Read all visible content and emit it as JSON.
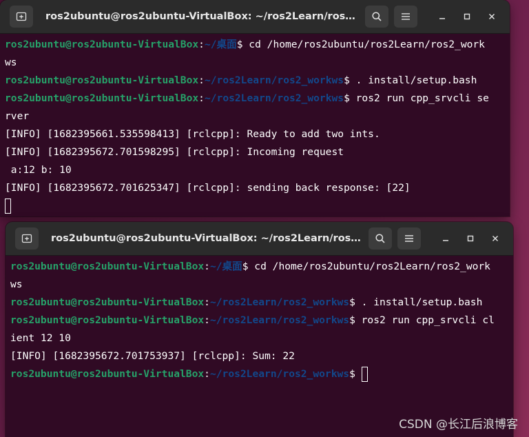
{
  "server": {
    "title": "ros2ubuntu@ros2ubuntu-VirtualBox: ~/ros2Learn/ros2_work...",
    "lines": [
      {
        "user": "ros2ubuntu@ros2ubuntu-VirtualBox",
        "colon": ":",
        "path": "~/桌面",
        "cmd": "$ cd /home/ros2ubuntu/ros2Learn/ros2_work"
      },
      {
        "text": "ws"
      },
      {
        "user": "ros2ubuntu@ros2ubuntu-VirtualBox",
        "colon": ":",
        "path": "~/ros2Learn/ros2_workws",
        "cmd": "$ . install/setup.bash"
      },
      {
        "user": "ros2ubuntu@ros2ubuntu-VirtualBox",
        "colon": ":",
        "path": "~/ros2Learn/ros2_workws",
        "cmd": "$ ros2 run cpp_srvcli se"
      },
      {
        "text": "rver"
      },
      {
        "text": "[INFO] [1682395661.535598413] [rclcpp]: Ready to add two ints."
      },
      {
        "text": "[INFO] [1682395672.701598295] [rclcpp]: Incoming request"
      },
      {
        "text": " a:12 b: 10"
      },
      {
        "text": "[INFO] [1682395672.701625347] [rclcpp]: sending back response: [22]"
      }
    ]
  },
  "client": {
    "title": "ros2ubuntu@ros2ubuntu-VirtualBox: ~/ros2Learn/ros2_work...",
    "lines": [
      {
        "user": "ros2ubuntu@ros2ubuntu-VirtualBox",
        "colon": ":",
        "path": "~/桌面",
        "cmd": "$ cd /home/ros2ubuntu/ros2Learn/ros2_work"
      },
      {
        "text": "ws"
      },
      {
        "user": "ros2ubuntu@ros2ubuntu-VirtualBox",
        "colon": ":",
        "path": "~/ros2Learn/ros2_workws",
        "cmd": "$ . install/setup.bash"
      },
      {
        "user": "ros2ubuntu@ros2ubuntu-VirtualBox",
        "colon": ":",
        "path": "~/ros2Learn/ros2_workws",
        "cmd": "$ ros2 run cpp_srvcli cl"
      },
      {
        "text": "ient 12 10"
      },
      {
        "text": "[INFO] [1682395672.701753937] [rclcpp]: Sum: 22"
      }
    ],
    "final_prompt": {
      "user": "ros2ubuntu@ros2ubuntu-VirtualBox",
      "colon": ":",
      "path": "~/ros2Learn/ros2_workws",
      "cmd": "$ "
    }
  },
  "watermark": "CSDN @长江后浪博客",
  "colors": {
    "terminal_bg": "#300a24",
    "titlebar_bg": "#2b2b2b",
    "prompt_user": "#26a269",
    "prompt_path": "#12488b"
  },
  "icons": {
    "new_tab": "new-tab-icon",
    "search": "search-icon",
    "menu": "hamburger-menu-icon",
    "minimize": "minimize-icon",
    "maximize": "maximize-icon",
    "close": "close-icon"
  }
}
